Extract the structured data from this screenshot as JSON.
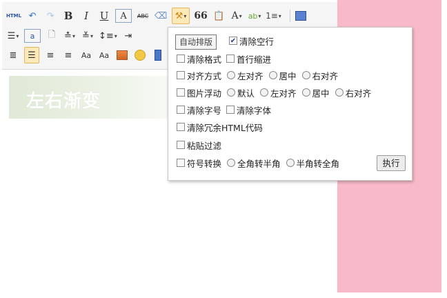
{
  "toolbar": {
    "row1": {
      "html": "HTML",
      "bold": "B",
      "italic": "I",
      "underline": "U",
      "fontborder": "A",
      "strike": "ABC",
      "autotypeset_caret": "▾",
      "quote": "66",
      "forecolor": "A",
      "backcolor": "ab",
      "orderedlist": "1≡"
    },
    "row2": {
      "link": "a"
    },
    "row3": {
      "font_smaller": "Aa",
      "font_larger": "Aa"
    }
  },
  "content": {
    "heading": "左右渐变"
  },
  "tooltip": "自动排版",
  "autotypeset": {
    "clear_empty_line": "清除空行",
    "clear_format": "清除格式",
    "indent": "首行缩进",
    "align": {
      "label": "对齐方式",
      "options": [
        "左对齐",
        "居中",
        "右对齐"
      ]
    },
    "image_float": {
      "label": "图片浮动",
      "options": [
        "默认",
        "左对齐",
        "居中",
        "右对齐"
      ]
    },
    "clear_font_size": "清除字号",
    "clear_font_family": "清除字体",
    "clear_redundant_html": "清除冗余HTML代码",
    "paste_filter": "粘贴过滤",
    "symbol_convert": {
      "label": "符号转换",
      "options": [
        "全角转半角",
        "半角转全角"
      ]
    },
    "execute": "执行"
  },
  "colors": {
    "pink_panel": "#f8b9c8",
    "active_button": "#fde8b8"
  }
}
